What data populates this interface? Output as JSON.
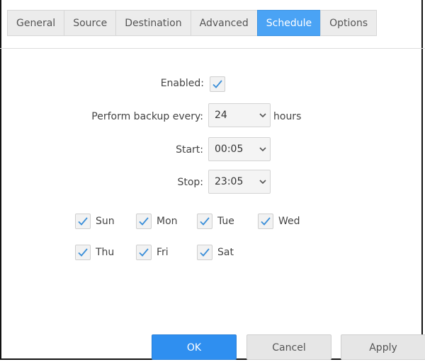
{
  "tabs": [
    {
      "label": "General",
      "active": false
    },
    {
      "label": "Source",
      "active": false
    },
    {
      "label": "Destination",
      "active": false
    },
    {
      "label": "Advanced",
      "active": false
    },
    {
      "label": "Schedule",
      "active": true
    },
    {
      "label": "Options",
      "active": false
    }
  ],
  "schedule": {
    "enabled_label": "Enabled:",
    "enabled": true,
    "interval_label": "Perform backup every:",
    "interval_value": "24",
    "interval_unit": "hours",
    "start_label": "Start:",
    "start_value": "00:05",
    "stop_label": "Stop:",
    "stop_value": "23:05",
    "days": [
      {
        "label": "Sun",
        "checked": true
      },
      {
        "label": "Mon",
        "checked": true
      },
      {
        "label": "Tue",
        "checked": true
      },
      {
        "label": "Wed",
        "checked": true
      },
      {
        "label": "Thu",
        "checked": true
      },
      {
        "label": "Fri",
        "checked": true
      },
      {
        "label": "Sat",
        "checked": true
      }
    ]
  },
  "buttons": {
    "ok": "OK",
    "cancel": "Cancel",
    "apply": "Apply"
  },
  "colors": {
    "accent": "#2f8ff0",
    "active_tab": "#4aa3f5",
    "check": "#3b8fd9"
  }
}
